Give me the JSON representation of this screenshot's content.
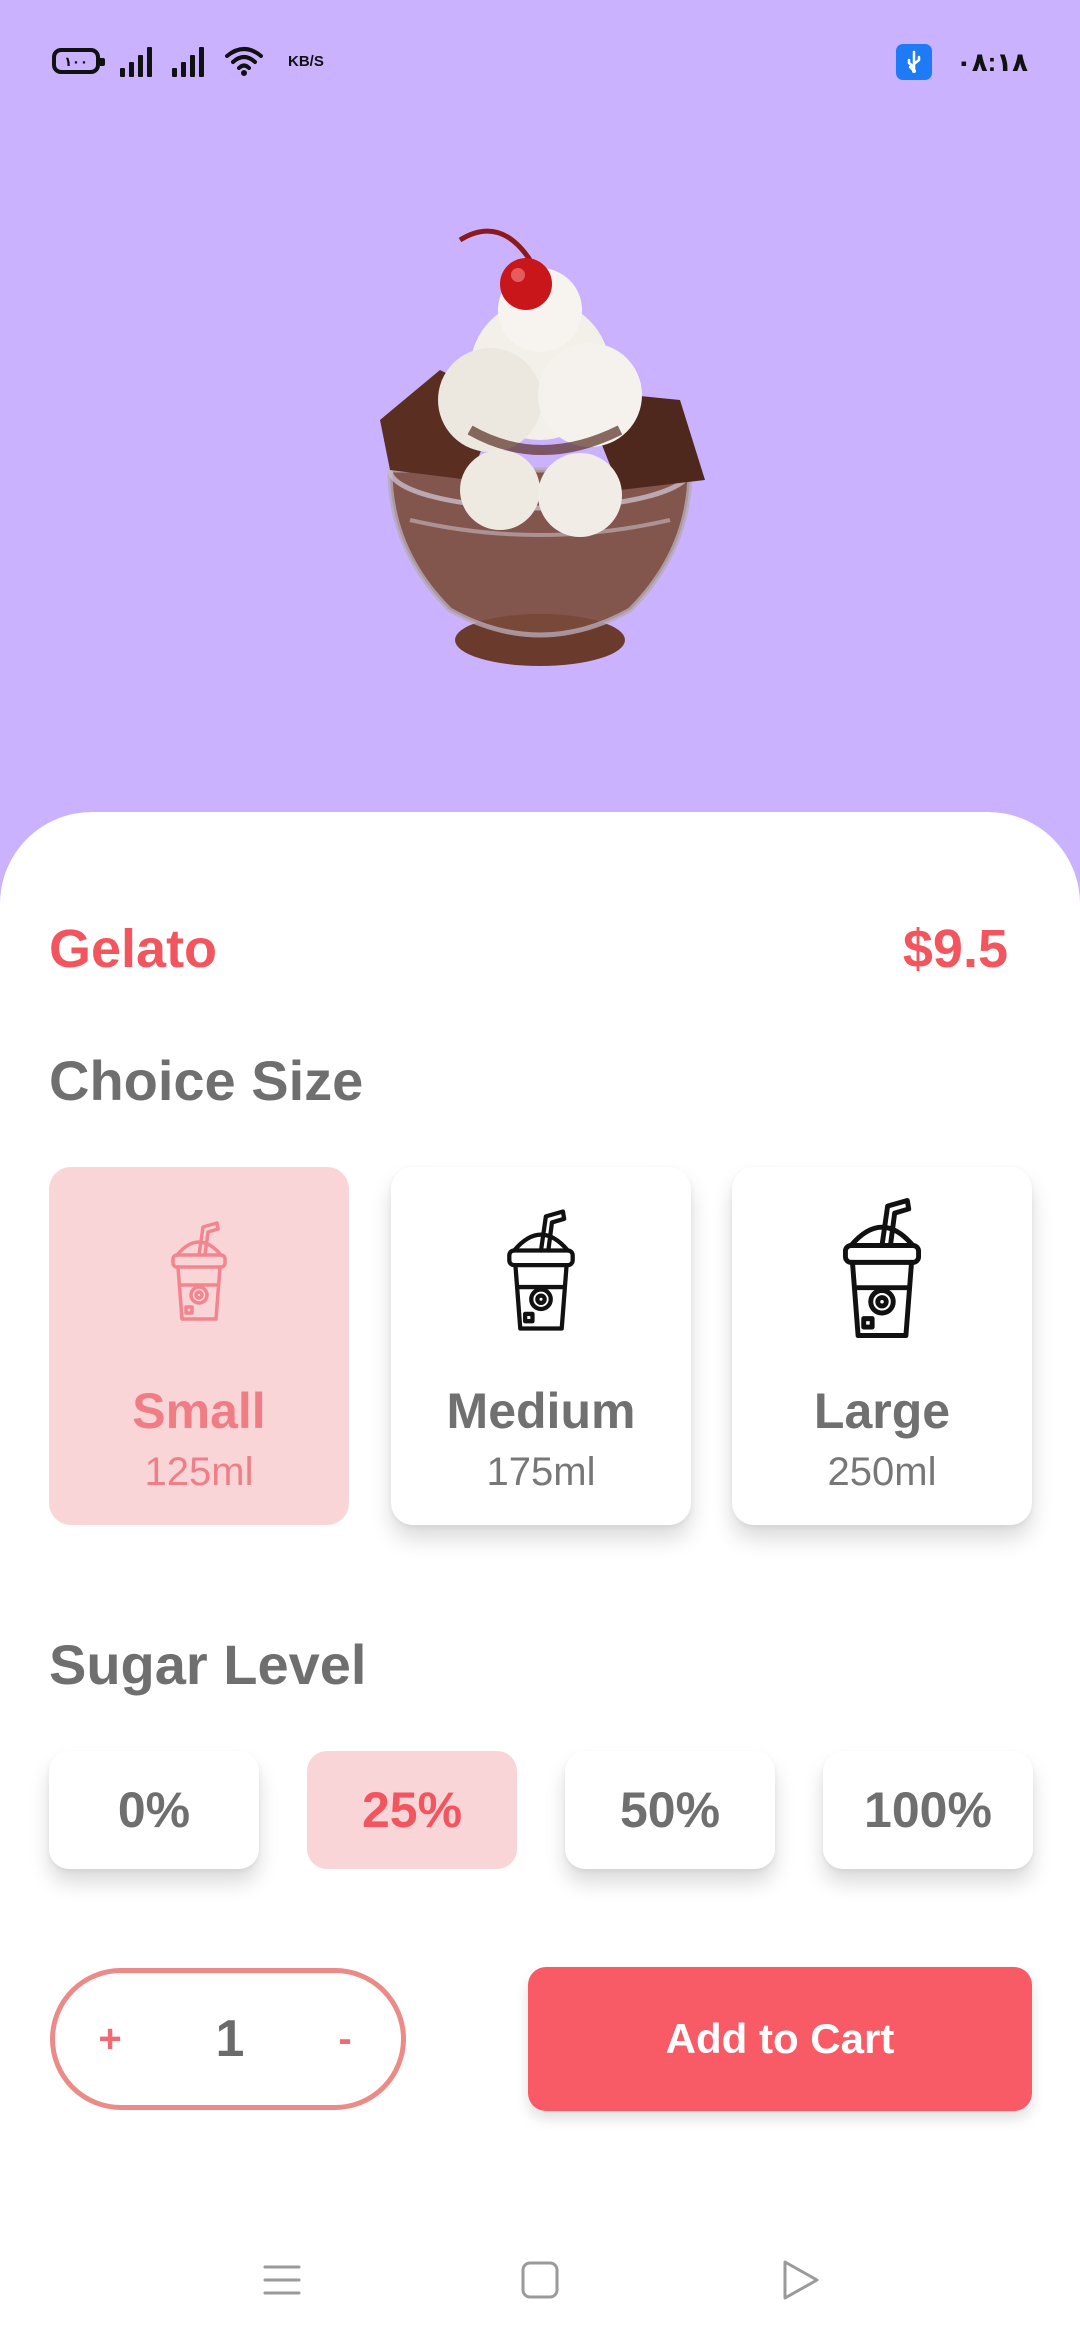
{
  "status_bar": {
    "battery_text": "١٠٠",
    "network_speed": "KB/S",
    "clock": "٠٨:١٨"
  },
  "product": {
    "name": "Gelato",
    "price": "$9.5",
    "image_icon": "ice-cream-sundae-image"
  },
  "size_section": {
    "title": "Choice Size",
    "options": [
      {
        "name": "Small",
        "volume": "125ml",
        "icon": "cup-icon"
      },
      {
        "name": "Medium",
        "volume": "175ml",
        "icon": "cup-icon"
      },
      {
        "name": "Large",
        "volume": "250ml",
        "icon": "cup-icon"
      }
    ],
    "selected": "Small"
  },
  "sugar_section": {
    "title": "Sugar Level",
    "options": [
      "0%",
      "25%",
      "50%",
      "100%"
    ],
    "selected": "25%"
  },
  "quantity": {
    "plus_label": "+",
    "value": "1",
    "minus_label": "-"
  },
  "cart_button": {
    "label": "Add to Cart"
  },
  "colors": {
    "background": "#cbb2fe",
    "accent": "#f85a66",
    "selected_bg": "#fad5d8",
    "usb_badge": "#1e7bf5"
  },
  "nav_bar": {
    "icons": [
      "menu-icon",
      "home-square-icon",
      "back-triangle-icon"
    ]
  }
}
